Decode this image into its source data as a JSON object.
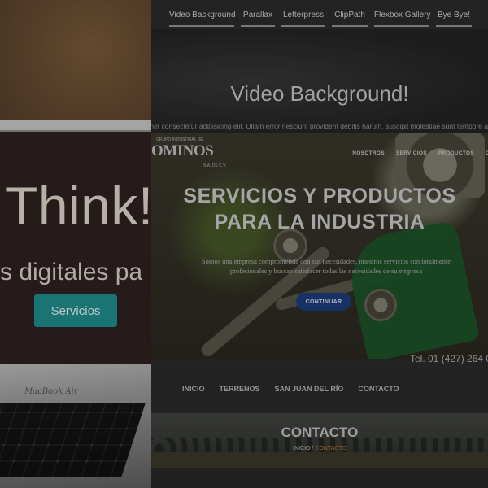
{
  "left_panel": {
    "headline": "Think!",
    "slogan": "s digitales pa",
    "button_label": "Servicios",
    "laptop_brand": "MacBook Air",
    "accent_color": "#1f8e8d"
  },
  "site": {
    "top_nav": [
      "Video Background",
      "Parallax",
      "Letterpress",
      "ClipPath",
      "Flexbox Gallery",
      "Bye Bye!"
    ],
    "header_title": "Video Background!",
    "lorem_line": "met consectetur adipisicing elit. Ullam error nesciunt provident debitis harum, suscipit molestiae sunt tempore ab",
    "brand": {
      "name": "OMINOS",
      "small_line": "GRUPO INDUSTRIAL DE",
      "sub_line": "S.A. DE C.V."
    },
    "hero_nav": [
      "NOSOTROS",
      "SERVICIOS",
      "PRODUCTOS",
      "C"
    ],
    "hero_title_line1": "SERVICIOS Y PRODUCTOS",
    "hero_title_line2": "PARA LA INDUSTRIA",
    "hero_text": "Somos una empresa comprometida con sus necesidades, nuestros servicios son totalmente profesionales y buscan satisfacer todas las necesidades de su empresa",
    "hero_button": "CONTINUAR",
    "phone": "Tel. 01 (427) 264 0",
    "sub_nav": [
      "INICIO",
      "TERRENOS",
      "SAN JUAN DEL RÍO",
      "CONTACTO"
    ],
    "contact_title": "CONTACTO",
    "breadcrumb_home": "INICIO /",
    "breadcrumb_current": "CONTACTO",
    "colors": {
      "button_blue": "#1f3f82",
      "breadcrumb_orange": "#c07a2a"
    }
  }
}
